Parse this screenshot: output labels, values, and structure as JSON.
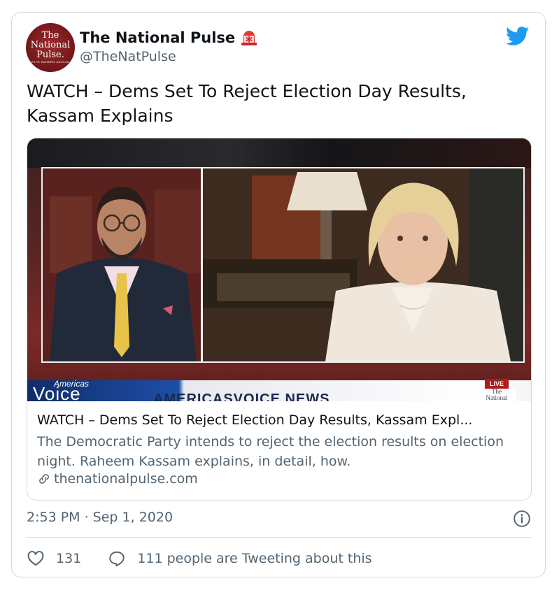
{
  "author": {
    "avatar_lines": [
      "The",
      "National",
      "Pulse.",
      "WITH RAHEEM KASSAM"
    ],
    "display_name": "The National Pulse",
    "handle": "@TheNatPulse",
    "badge_icon": "siren-icon"
  },
  "platform_icon": "twitter-bird-icon",
  "tweet_text": "WATCH – Dems Set To Reject Election Day Results, Kassam Explains",
  "card": {
    "media": {
      "brand_small": "Americas",
      "brand_large": "Voice",
      "network_text": "AMERICASVOICE NEWS",
      "live_label": "LIVE",
      "corner_logo_lines": [
        "The",
        "National"
      ]
    },
    "title": "WATCH – Dems Set To Reject Election Day Results, Kassam Expl...",
    "description": "The Democratic Party intends to reject the election results on election night. Raheem Kassam explains, in detail, how.",
    "domain": "thenationalpulse.com",
    "domain_icon": "link-icon"
  },
  "timestamp": "2:53 PM · Sep 1, 2020",
  "info_icon": "info-icon",
  "actions": {
    "like_count": "131",
    "reply_label": "111 people are Tweeting about this"
  },
  "colors": {
    "text": "#0f1419",
    "secondary_text": "#536471",
    "border": "#cfd9de",
    "twitter_blue": "#1d9bf0",
    "avatar_red": "#7a1a1c"
  }
}
